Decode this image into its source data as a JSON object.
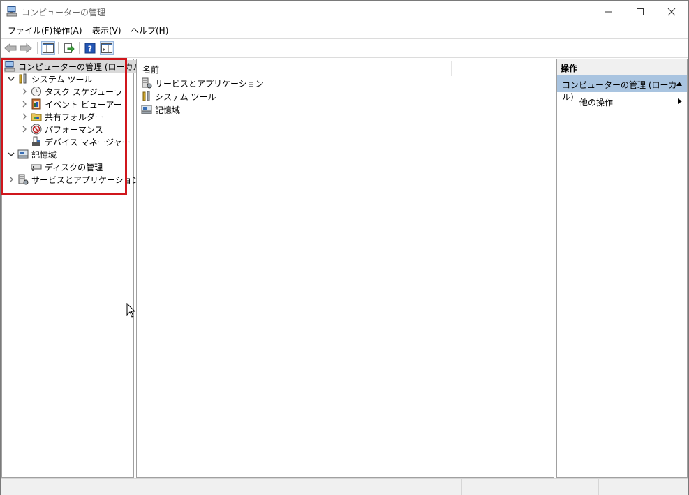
{
  "window": {
    "title": "コンピューターの管理"
  },
  "menu": [
    "ファイル(F)",
    "操作(A)",
    "表示(V)",
    "ヘルプ(H)"
  ],
  "tree": {
    "root": "コンピューターの管理 (ローカル)",
    "system_tools": "システム ツール",
    "task_scheduler": "タスク スケジューラ",
    "event_viewer": "イベント ビューアー",
    "shared_folders": "共有フォルダー",
    "performance": "パフォーマンス",
    "device_manager": "デバイス マネージャー",
    "storage": "記憶域",
    "disk_management": "ディスクの管理",
    "services_apps": "サービスとアプリケーション"
  },
  "list": {
    "column_name": "名前",
    "items": [
      "サービスとアプリケーション",
      "システム ツール",
      "記憶域"
    ]
  },
  "actions": {
    "title": "操作",
    "section": "コンピューターの管理 (ローカル)",
    "other": "他の操作"
  },
  "colors": {
    "highlight": "#d0161c",
    "action_section": "#a9c4e0"
  }
}
